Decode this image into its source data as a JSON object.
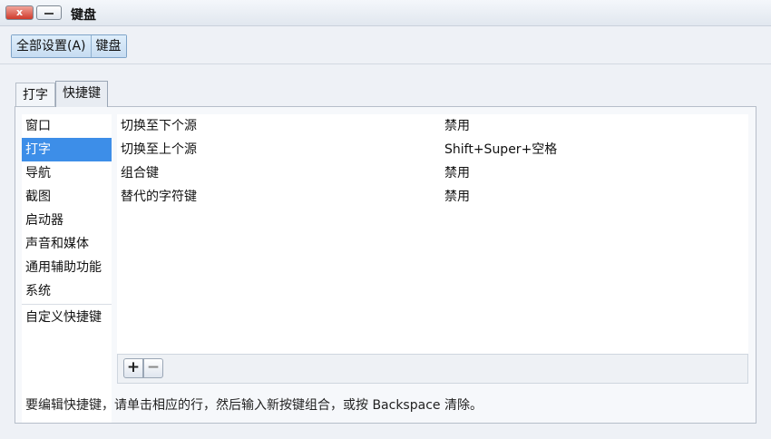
{
  "window": {
    "title": "键盘",
    "close_symbol": "x"
  },
  "breadcrumb": {
    "items": [
      "全部设置(A)",
      "键盘"
    ]
  },
  "tabs": [
    {
      "label": "打字",
      "active": false
    },
    {
      "label": "快捷键",
      "active": true
    }
  ],
  "sidebar": {
    "items": [
      "窗口",
      "打字",
      "导航",
      "截图",
      "启动器",
      "声音和媒体",
      "通用辅助功能",
      "系统"
    ],
    "selected": "打字",
    "custom": "自定义快捷键"
  },
  "shortcuts": [
    {
      "name": "切换至下个源",
      "key": "禁用"
    },
    {
      "name": "切换至上个源",
      "key": "Shift+Super+空格"
    },
    {
      "name": "组合键",
      "key": "禁用"
    },
    {
      "name": "替代的字符键",
      "key": "禁用"
    }
  ],
  "toolbar": {
    "add_symbol": "+",
    "remove_symbol": "−"
  },
  "hint": "要编辑快捷键，请单击相应的行，然后输入新按键组合，或按 Backspace 清除。",
  "colors": {
    "selection": "#3d8ee8",
    "close_button": "#cf3a2b"
  }
}
